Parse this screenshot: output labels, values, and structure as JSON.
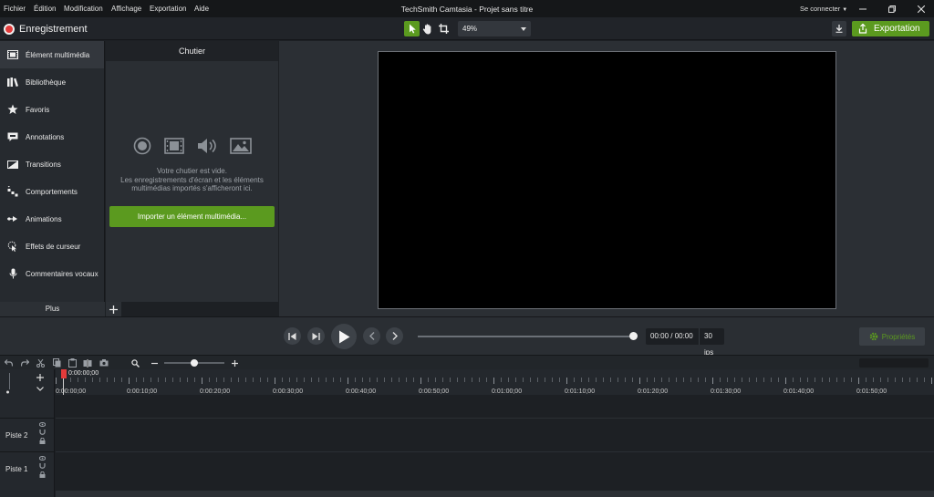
{
  "menu": {
    "items": [
      "Fichier",
      "Édition",
      "Modification",
      "Affichage",
      "Exportation",
      "Aide"
    ],
    "app_title": "TechSmith Camtasia - Projet sans titre",
    "account_label": "Se connecter"
  },
  "toolbar": {
    "record_label": "Enregistrement",
    "zoom_value": "49%",
    "export_label": "Exportation"
  },
  "sidebar": {
    "items": [
      {
        "label": "Élément multimédia",
        "icon": "film-icon",
        "selected": true
      },
      {
        "label": "Bibliothèque",
        "icon": "library-icon",
        "selected": false
      },
      {
        "label": "Favoris",
        "icon": "star-icon",
        "selected": false
      },
      {
        "label": "Annotations",
        "icon": "annotation-icon",
        "selected": false
      },
      {
        "label": "Transitions",
        "icon": "transition-icon",
        "selected": false
      },
      {
        "label": "Comportements",
        "icon": "behavior-icon",
        "selected": false
      },
      {
        "label": "Animations",
        "icon": "animation-icon",
        "selected": false
      },
      {
        "label": "Effets de curseur",
        "icon": "cursor-effect-icon",
        "selected": false
      },
      {
        "label": "Commentaires vocaux",
        "icon": "microphone-icon",
        "selected": false
      }
    ],
    "more_label": "Plus"
  },
  "bin": {
    "title": "Chutier",
    "empty_line1": "Votre chutier est vide.",
    "empty_line2": "Les enregistrements d'écran et les éléments",
    "empty_line3": "multimédias importés s'afficheront ici.",
    "import_label": "Importer un élément multimédia..."
  },
  "playback": {
    "timecode": "00:00 / 00:00",
    "fps": "30 ips",
    "properties_label": "Propriétés",
    "position": 1.0
  },
  "timeline": {
    "playhead_time": "0:00:00;00",
    "zoom_level": 0.5,
    "ticks": [
      "0:00:00;00",
      "0:00:10;00",
      "0:00:20;00",
      "0:00:30;00",
      "0:00:40;00",
      "0:00:50;00",
      "0:01:00;00",
      "0:01:10;00",
      "0:01:20;00",
      "0:01:30;00",
      "0:01:40;00",
      "0:01:50;00"
    ],
    "tracks": [
      "Piste 2",
      "Piste 1"
    ]
  },
  "colors": {
    "accent_green": "#5b9a1f",
    "record_red": "#e33b3b"
  }
}
